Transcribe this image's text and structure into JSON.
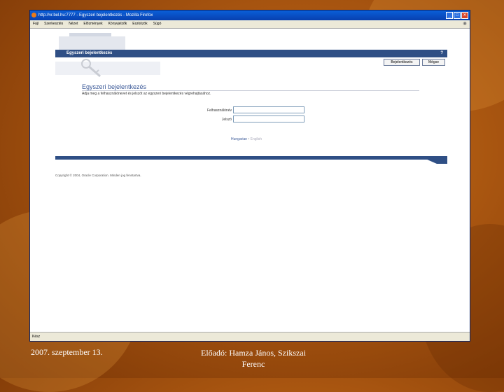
{
  "browser": {
    "window_title": "http://vr.bel.hu:7777 - Egyszeri bejelentkezés - Mozilla Firefox",
    "menu": [
      "Fájl",
      "Szerkesztés",
      "Nézet",
      "Előzmények",
      "Könyvjelzők",
      "Eszközök",
      "Súgó"
    ],
    "status_text": "Kész"
  },
  "page": {
    "header_title": "Egyszeri bejelentkezés",
    "help": "?",
    "login_button": "Bejelentkezés",
    "cancel_button": "Mégse",
    "login_heading": "Egyszeri bejelentkezés",
    "login_description": "Adja meg a felhasználónevet és jelszót az egyszeri bejelentkezés végrehajtásához.",
    "username_label": "Felhasználónév",
    "password_label": "Jelszó",
    "lang_hungarian": "Hungarian",
    "lang_sep": "•",
    "lang_english": "English",
    "copyright": "Copyright © 2004, Oracle Corporation. Minden jog fenntartva."
  },
  "slide": {
    "date": "2007. szeptember 13.",
    "presenter_line1": "Előadó: Hamza János, Szikszai",
    "presenter_line2": "Ferenc"
  }
}
